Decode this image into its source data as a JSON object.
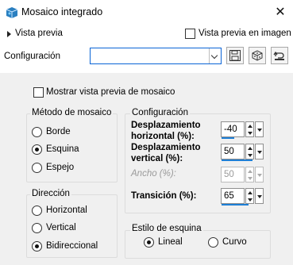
{
  "window": {
    "title": "Mosaico integrado",
    "close_glyph": "✕"
  },
  "preview": {
    "label": "Vista previa",
    "in_image_label": "Vista previa en imagen",
    "in_image_checked": false
  },
  "config": {
    "label": "Configuración",
    "value": ""
  },
  "tile_preview": {
    "label": "Mostrar vista previa de mosaico",
    "checked": false
  },
  "method": {
    "title": "Método de mosaico",
    "options": [
      "Borde",
      "Esquina",
      "Espejo"
    ],
    "selected": "Esquina"
  },
  "settings": {
    "title": "Configuración",
    "h_offset": {
      "label_line1": "Desplazamiento",
      "label_line2": "horizontal (%):",
      "value": "-40",
      "fill": 0.3
    },
    "v_offset": {
      "label_line1": "Desplazamiento",
      "label_line2": "vertical (%):",
      "value": "50",
      "fill": 0.75
    },
    "width": {
      "label": "Ancho (%):",
      "value": "50",
      "disabled": true
    },
    "transition": {
      "label": "Transición (%):",
      "value": "65",
      "fill": 0.65
    }
  },
  "direction": {
    "title": "Dirección",
    "options": [
      "Horizontal",
      "Vertical",
      "Bidireccional"
    ],
    "selected": "Bidireccional"
  },
  "corner_style": {
    "title": "Estilo de esquina",
    "options": [
      "Lineal",
      "Curvo"
    ],
    "selected": "Lineal"
  },
  "toolbar_icons": [
    "save-icon",
    "dice-icon",
    "reset-icon"
  ],
  "colors": {
    "accent": "#1e7fd6",
    "focus_border": "#0a64d6",
    "panel_bg": "#f0f0f0"
  }
}
